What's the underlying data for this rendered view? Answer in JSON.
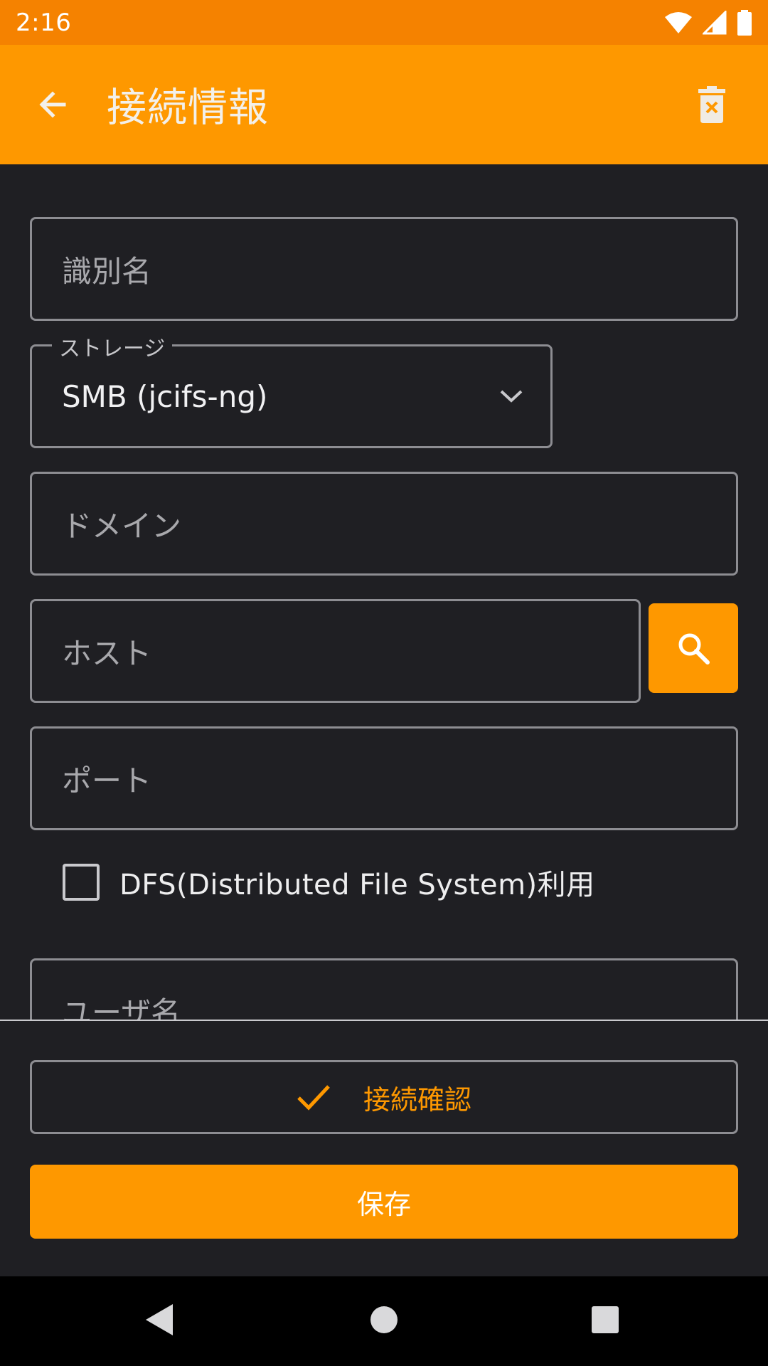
{
  "status_bar": {
    "time": "2:16",
    "icons": [
      "wifi-icon",
      "cell-signal-icon",
      "battery-icon"
    ]
  },
  "app_bar": {
    "title": "接続情報",
    "back_icon": "arrow-back-icon",
    "delete_icon": "delete-icon"
  },
  "form": {
    "identifier": {
      "placeholder": "識別名",
      "value": ""
    },
    "storage": {
      "label": "ストレージ",
      "value": "SMB (jcifs-ng)"
    },
    "domain": {
      "placeholder": "ドメイン",
      "value": ""
    },
    "host": {
      "placeholder": "ホスト",
      "value": ""
    },
    "port": {
      "placeholder": "ポート",
      "value": ""
    },
    "dfs": {
      "label": "DFS(Distributed File System)利用",
      "checked": false
    },
    "username": {
      "placeholder": "ユーザ名",
      "value": ""
    }
  },
  "actions": {
    "verify_label": "接続確認",
    "save_label": "保存"
  },
  "colors": {
    "accent": "#fe9800",
    "status_bar": "#f58200",
    "background": "#1f1f23"
  }
}
